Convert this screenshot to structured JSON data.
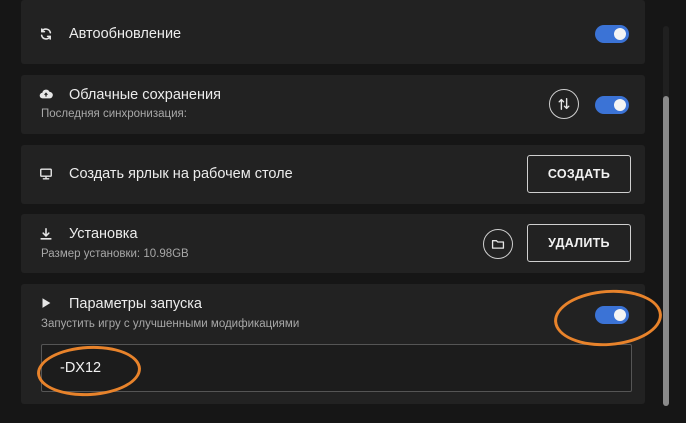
{
  "settings": {
    "auto_update": {
      "title": "Автообновление",
      "enabled": true,
      "icon": "refresh-icon"
    },
    "cloud_saves": {
      "title": "Облачные сохранения",
      "subtitle": "Последняя синхронизация:",
      "enabled": true,
      "icon": "cloud-upload-icon",
      "sync_icon": "sync-icon"
    },
    "desktop_shortcut": {
      "title": "Создать ярлык на рабочем столе",
      "button_label": "СОЗДАТЬ",
      "icon": "monitor-icon"
    },
    "install": {
      "title": "Установка",
      "subtitle": "Размер установки: 10.98GB",
      "button_label": "УДАЛИТЬ",
      "icon": "download-icon",
      "folder_icon": "folder-icon"
    },
    "launch_params": {
      "title": "Параметры запуска",
      "subtitle": "Запустить игру с улучшенными модификациями",
      "enabled": true,
      "value": "-DX12",
      "icon": "play-icon"
    }
  },
  "colors": {
    "background": "#161616",
    "panel": "#222222",
    "accent": "#3b73d6",
    "highlight": "#e8832b"
  }
}
